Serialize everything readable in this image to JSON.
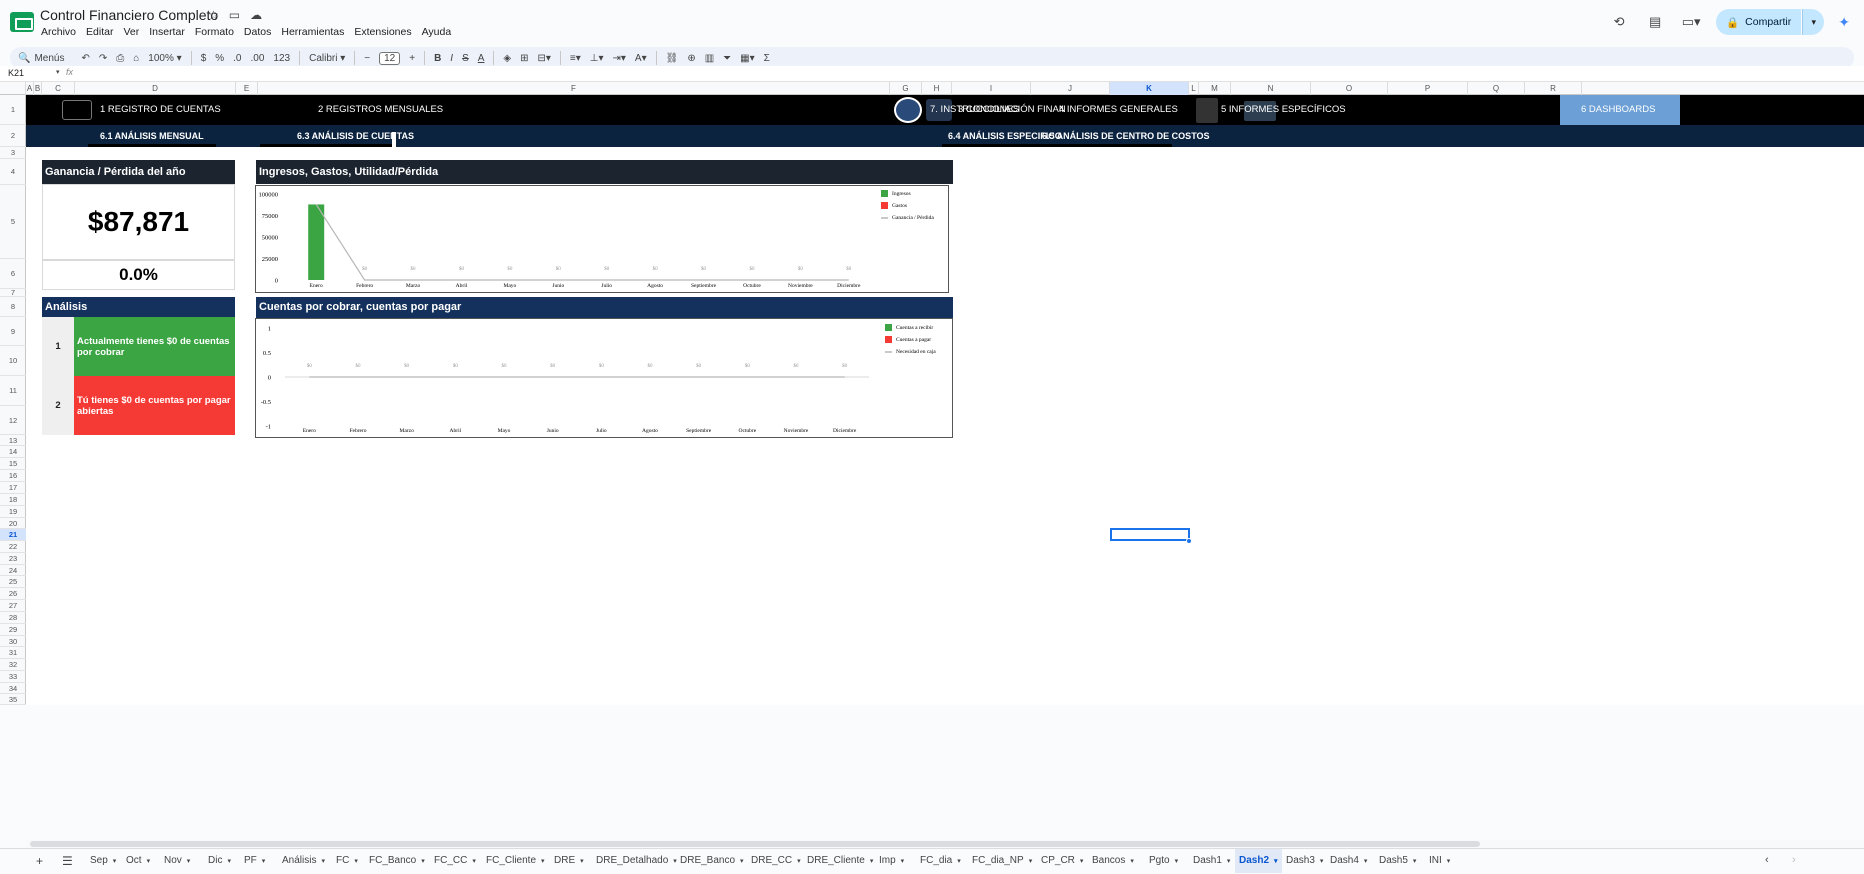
{
  "app": {
    "title": "Control Financiero Completo",
    "menu": [
      "Archivo",
      "Editar",
      "Ver",
      "Insertar",
      "Formato",
      "Datos",
      "Herramientas",
      "Extensiones",
      "Ayuda"
    ],
    "share_label": "Compartir"
  },
  "toolbar": {
    "search": "Menús",
    "zoom": "100%",
    "currency": "$",
    "percent": "%",
    "dec_less": ".0",
    "dec_more": ".00",
    "number_format": "123",
    "font": "Calibri",
    "font_size": "12"
  },
  "formula": {
    "namebox": "K21",
    "fx": "fx"
  },
  "columns": [
    "A",
    "B",
    "C",
    "D",
    "E",
    "F",
    "G",
    "H",
    "I",
    "J",
    "K",
    "L",
    "M",
    "N",
    "O",
    "P",
    "Q",
    "R"
  ],
  "rows": [
    "1",
    "2",
    "3",
    "4",
    "5",
    "6",
    "7",
    "8",
    "9",
    "10",
    "11",
    "12",
    "13",
    "14",
    "15",
    "16",
    "17",
    "18",
    "19",
    "20",
    "21",
    "22",
    "23",
    "24",
    "25",
    "26",
    "27",
    "28",
    "29",
    "30",
    "31",
    "32",
    "33",
    "34",
    "35"
  ],
  "nav": {
    "main": [
      "1 REGISTRO DE CUENTAS",
      "2 REGISTROS MENSUALES",
      "7. INSTRUCCIONES",
      "3 CONCILIACIÓN FINAN",
      "4 INFORMES GENERALES",
      "5 INFORMES ESPECÍFICOS",
      "6 DASHBOARDS"
    ],
    "sub": [
      "6.1 ANÁLISIS MENSUAL",
      "6.3 ANÁLISIS DE CUENTAS",
      "6.4 ANÁLISIS ESPECIFICO",
      "6.5 ANÁLISIS DE CENTRO DE COSTOS"
    ]
  },
  "kpi": {
    "title": "Ganancia / Pérdida del año",
    "value": "$87,871",
    "percent": "0.0%"
  },
  "analysis": {
    "title": "Análisis",
    "items": [
      {
        "num": "1",
        "text": "Actualmente tienes $0 de cuentas por cobrar"
      },
      {
        "num": "2",
        "text": "Tú tienes $0 de cuentas por pagar abiertas"
      }
    ]
  },
  "colors": {
    "nav_active": "#6b9fd6",
    "nav2": "#0c2340",
    "header_dark": "#1c2430",
    "header_navy": "#14305c",
    "green": "#3ba544",
    "red": "#f53a36",
    "selection": "#1a73e8"
  },
  "chart_data": [
    {
      "type": "bar",
      "title": "Ingresos, Gastos, Utilidad/Pérdida",
      "categories": [
        "Enero",
        "Febrero",
        "Marzo",
        "Abril",
        "Mayo",
        "Junio",
        "Julio",
        "Agosto",
        "Septiembre",
        "Octubre",
        "Noviembre",
        "Diciembre"
      ],
      "series": [
        {
          "name": "Ingresos",
          "kind": "bar",
          "color": "#3ba544",
          "values": [
            87871,
            0,
            0,
            0,
            0,
            0,
            0,
            0,
            0,
            0,
            0,
            0
          ]
        },
        {
          "name": "Gastos",
          "kind": "bar",
          "color": "#f53a36",
          "values": [
            0,
            0,
            0,
            0,
            0,
            0,
            0,
            0,
            0,
            0,
            0,
            0
          ]
        },
        {
          "name": "Ganancia / Pérdida",
          "kind": "line",
          "color": "#b7b7b7",
          "values": [
            87871,
            0,
            0,
            0,
            0,
            0,
            0,
            0,
            0,
            0,
            0,
            0
          ]
        }
      ],
      "data_labels": [
        "$0",
        "$0",
        "$0",
        "$0",
        "$0",
        "$0",
        "$0",
        "$0",
        "$0",
        "$0",
        "$0"
      ],
      "yticks": [
        "0",
        "25000",
        "50000",
        "75000",
        "100000"
      ],
      "ylim": [
        0,
        100000
      ],
      "legend": "top-right"
    },
    {
      "type": "bar",
      "title": "Cuentas por cobrar, cuentas por pagar",
      "categories": [
        "Enero",
        "Febrero",
        "Marzo",
        "Abril",
        "Mayo",
        "Junio",
        "Julio",
        "Agosto",
        "Septiembre",
        "Octubre",
        "Noviembre",
        "Diciembre"
      ],
      "series": [
        {
          "name": "Cuentas a recibir",
          "kind": "bar",
          "color": "#3ba544",
          "values": [
            0,
            0,
            0,
            0,
            0,
            0,
            0,
            0,
            0,
            0,
            0,
            0
          ]
        },
        {
          "name": "Cuentas a pagar",
          "kind": "bar",
          "color": "#f53a36",
          "values": [
            0,
            0,
            0,
            0,
            0,
            0,
            0,
            0,
            0,
            0,
            0,
            0
          ]
        },
        {
          "name": "Necesidad en caja",
          "kind": "line",
          "color": "#b7b7b7",
          "values": [
            0,
            0,
            0,
            0,
            0,
            0,
            0,
            0,
            0,
            0,
            0,
            0
          ]
        }
      ],
      "data_labels": [
        "$0",
        "$0",
        "$0",
        "$0",
        "$0",
        "$0",
        "$0",
        "$0",
        "$0",
        "$0",
        "$0",
        "$0"
      ],
      "yticks": [
        "-1",
        "-0.5",
        "0",
        "0.5",
        "1"
      ],
      "ylim": [
        -1,
        1
      ],
      "legend": "top-right"
    }
  ],
  "sheets": [
    "Sep",
    "Oct",
    "Nov",
    "Dic",
    "PF",
    "Análisis",
    "FC",
    "FC_Banco",
    "FC_CC",
    "FC_Cliente",
    "DRE",
    "DRE_Detalhado",
    "DRE_Banco",
    "DRE_CC",
    "DRE_Cliente",
    "Imp",
    "FC_dia",
    "FC_dia_NP",
    "CP_CR",
    "Bancos",
    "Pgto",
    "Dash1",
    "Dash2",
    "Dash3",
    "Dash4",
    "Dash5",
    "INI"
  ],
  "active_sheet": "Dash2"
}
